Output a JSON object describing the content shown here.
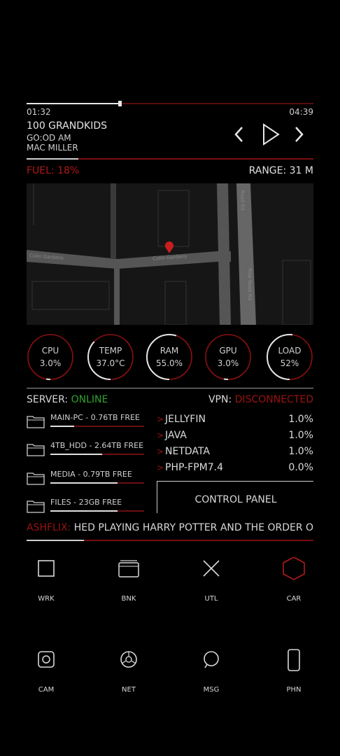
{
  "media": {
    "elapsed": "01:32",
    "duration": "04:39",
    "progress": 0.32,
    "title": "100 GRANDKIDS",
    "album": "GO:OD AM",
    "artist": "MAC MILLER"
  },
  "vehicle": {
    "fuel_label": "FUEL: 18%",
    "range_label": "RANGE: 31 M",
    "map_streets": [
      "Colin Gardens",
      "Colin Gardens",
      "Road Rd",
      "Rise Road Rd"
    ]
  },
  "gauges": [
    {
      "name": "CPU",
      "value": "3.0%",
      "level": 0.03
    },
    {
      "name": "TEMP",
      "value": "37.0°C",
      "level": 0.37
    },
    {
      "name": "RAM",
      "value": "55.0%",
      "level": 0.55
    },
    {
      "name": "GPU",
      "value": "3.0%",
      "level": 0.03
    },
    {
      "name": "LOAD",
      "value": "52%",
      "level": 0.52
    }
  ],
  "server": {
    "label": "SERVER: ",
    "status": "ONLINE",
    "vpn_label": "VPN: ",
    "vpn_status": "DISCONNECTED"
  },
  "drives": [
    {
      "label": "MAIN-PC - 0.76TB FREE",
      "used": 0.25
    },
    {
      "label": "4TB_HDD - 2.64TB FREE",
      "used": 0.55
    },
    {
      "label": "MEDIA - 0.79TB FREE",
      "used": 0.72
    },
    {
      "label": "FILES - 23GB FREE",
      "used": 0.72
    }
  ],
  "services": [
    {
      "name": "JELLYFIN",
      "value": "1.0%"
    },
    {
      "name": "JAVA",
      "value": "1.0%"
    },
    {
      "name": "NETDATA",
      "value": "1.0%"
    },
    {
      "name": "PHP-FPM7.4",
      "value": "0.0%"
    }
  ],
  "control_panel": "CONTROL PANEL",
  "ticker": {
    "source": "ASHFLIX: ",
    "message": "HED PLAYING HARRY POTTER AND THE ORDER O..."
  },
  "apps_row1": [
    {
      "label": "WRK",
      "icon": "square-icon"
    },
    {
      "label": "BNK",
      "icon": "wallet-icon"
    },
    {
      "label": "UTL",
      "icon": "cross-icon"
    },
    {
      "label": "CAR",
      "icon": "hexagon-icon"
    }
  ],
  "apps_row2": [
    {
      "label": "CAM",
      "icon": "camera-icon"
    },
    {
      "label": "NET",
      "icon": "browser-icon"
    },
    {
      "label": "MSG",
      "icon": "chat-icon"
    },
    {
      "label": "PHN",
      "icon": "phone-icon"
    }
  ],
  "colors": {
    "accent_red": "#9b1212",
    "online_green": "#2fa32f",
    "background": "#000000"
  }
}
